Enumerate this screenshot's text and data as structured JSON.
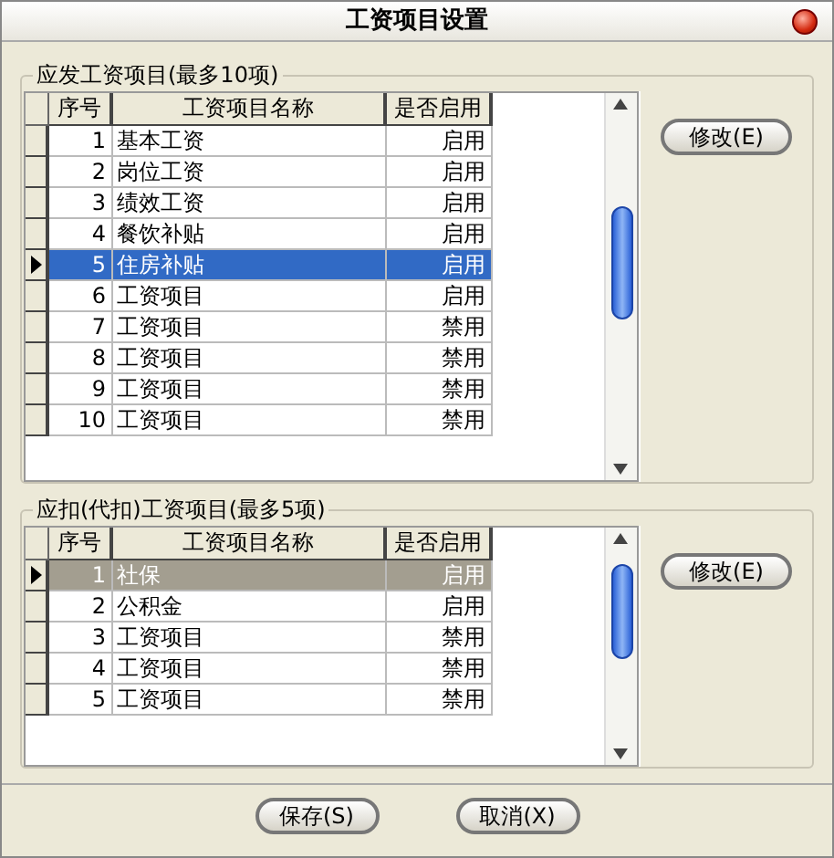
{
  "window": {
    "title": "工资项目设置"
  },
  "groups": [
    {
      "title": "应发工资项目(最多10项)",
      "focused": true,
      "columns": [
        "序号",
        "工资项目名称",
        "是否启用"
      ],
      "button": "修改(E)",
      "rows": [
        {
          "no": "1",
          "name": "基本工资",
          "status": "启用",
          "selected": false
        },
        {
          "no": "2",
          "name": "岗位工资",
          "status": "启用",
          "selected": false
        },
        {
          "no": "3",
          "name": "绩效工资",
          "status": "启用",
          "selected": false
        },
        {
          "no": "4",
          "name": "餐饮补贴",
          "status": "启用",
          "selected": false
        },
        {
          "no": "5",
          "name": "住房补贴",
          "status": "启用",
          "selected": true
        },
        {
          "no": "6",
          "name": "工资项目",
          "status": "启用",
          "selected": false
        },
        {
          "no": "7",
          "name": "工资项目",
          "status": "禁用",
          "selected": false
        },
        {
          "no": "8",
          "name": "工资项目",
          "status": "禁用",
          "selected": false
        },
        {
          "no": "9",
          "name": "工资项目",
          "status": "禁用",
          "selected": false
        },
        {
          "no": "10",
          "name": "工资项目",
          "status": "禁用",
          "selected": false
        }
      ]
    },
    {
      "title": "应扣(代扣)工资项目(最多5项)",
      "focused": false,
      "columns": [
        "序号",
        "工资项目名称",
        "是否启用"
      ],
      "button": "修改(E)",
      "rows": [
        {
          "no": "1",
          "name": "社保",
          "status": "启用",
          "selected": true
        },
        {
          "no": "2",
          "name": "公积金",
          "status": "启用",
          "selected": false
        },
        {
          "no": "3",
          "name": "工资项目",
          "status": "禁用",
          "selected": false
        },
        {
          "no": "4",
          "name": "工资项目",
          "status": "禁用",
          "selected": false
        },
        {
          "no": "5",
          "name": "工资项目",
          "status": "禁用",
          "selected": false
        }
      ]
    }
  ],
  "buttons": [
    "保存(S)",
    "取消(X)"
  ]
}
